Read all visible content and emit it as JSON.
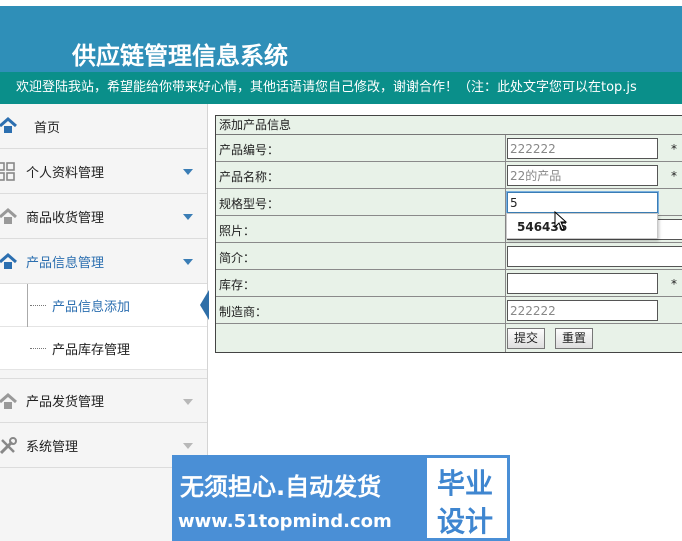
{
  "header": {
    "title": "供应链管理信息系统"
  },
  "marquee": {
    "text": "欢迎登陆我站，希望能给你带来好心情，其他话语请您自己修改，谢谢合作！（注：此处文字您可以在top.js"
  },
  "sidebar": {
    "home": "首页",
    "items": [
      {
        "label": "个人资料管理",
        "icon": "grid-icon"
      },
      {
        "label": "商品收货管理",
        "icon": "house-icon"
      },
      {
        "label": "产品信息管理",
        "icon": "house-icon"
      },
      {
        "label": "产品发货管理",
        "icon": "house-icon"
      },
      {
        "label": "系统管理",
        "icon": "tools-icon"
      }
    ],
    "subitems": [
      {
        "label": "产品信息添加"
      },
      {
        "label": "产品库存管理"
      }
    ]
  },
  "form": {
    "caption": "添加产品信息",
    "fields": [
      {
        "label": "产品编号：",
        "value": "222222",
        "required": "*"
      },
      {
        "label": "产品名称：",
        "value": "22的产品",
        "required": "*"
      },
      {
        "label": "规格型号：",
        "value": "5",
        "required": ""
      },
      {
        "label": "照片：",
        "value": "",
        "required": ""
      },
      {
        "label": "简介：",
        "value": "",
        "required": ""
      },
      {
        "label": "库存：",
        "value": "",
        "required": "*"
      },
      {
        "label": "制造商：",
        "value": "222222",
        "required": ""
      }
    ],
    "submit_label": "提交",
    "reset_label": "重置"
  },
  "autocomplete": {
    "suggestion": "546436"
  },
  "banner": {
    "line1": "无须担心.自动发货",
    "line2": "www.51topmind.com",
    "badge_top": "毕业",
    "badge_bottom": "设计"
  },
  "colors": {
    "header_bg": "#2f8fb8",
    "marquee_bg": "#0a8f8a",
    "accent": "#2c6fb0",
    "form_bg": "#e8f2e8",
    "banner_bg": "#4a8fd6"
  }
}
